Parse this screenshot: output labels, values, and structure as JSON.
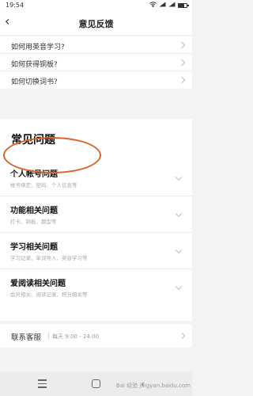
{
  "status_bar": {
    "time": "19:54",
    "system_icons": [
      "wifi-icon",
      "sim-signal-icon",
      "battery-icon"
    ]
  },
  "nav": {
    "back_glyph": "‹",
    "title": "意见反馈"
  },
  "faq_items": [
    {
      "label": "如何用英音学习?"
    },
    {
      "label": "如何获得铜板?"
    },
    {
      "label": "如何切换词书?"
    }
  ],
  "common": {
    "heading": "常见问题",
    "categories": [
      {
        "title": "个人帐号问题",
        "subtitle": "帐号绑定、密码、个人信息等"
      },
      {
        "title": "功能相关问题",
        "subtitle": "打卡、铜板、题型等"
      },
      {
        "title": "学习相关问题",
        "subtitle": "学习记录、单词导入、英音学习等"
      },
      {
        "title": "爱阅读相关问题",
        "subtitle": "会员相关、阅读记录、积分相关等"
      }
    ]
  },
  "service": {
    "label": "联系客服",
    "hours": "每天 9:00 - 24:00"
  },
  "watermark": {
    "text": "Bai 经验 jingyan.baidu.com"
  },
  "colors": {
    "highlight": "#d9622b",
    "background": "#f3f3f3"
  }
}
